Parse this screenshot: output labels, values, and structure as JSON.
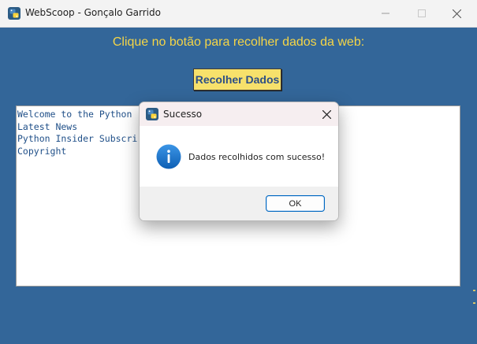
{
  "window": {
    "title": "WebScoop - Gonçalo Garrido"
  },
  "main": {
    "prompt": "Clique no botão para recolher dados da web:",
    "collect_button": "Recolher Dados",
    "output_lines": [
      "Welcome to the Python",
      "Latest News",
      "Python Insider Subscri",
      "Copyright"
    ]
  },
  "dialog": {
    "title": "Sucesso",
    "message": "Dados recolhidos com sucesso!",
    "ok_label": "OK"
  },
  "colors": {
    "window_background": "#336699",
    "label_text": "#f5d547",
    "button_background": "#f7e16b",
    "button_text": "#2d4f86",
    "output_text": "#1f4f88",
    "info_icon": "#1a73c9"
  },
  "icons": {
    "app": "python-icon",
    "dialog": "python-icon",
    "message": "info-icon"
  }
}
